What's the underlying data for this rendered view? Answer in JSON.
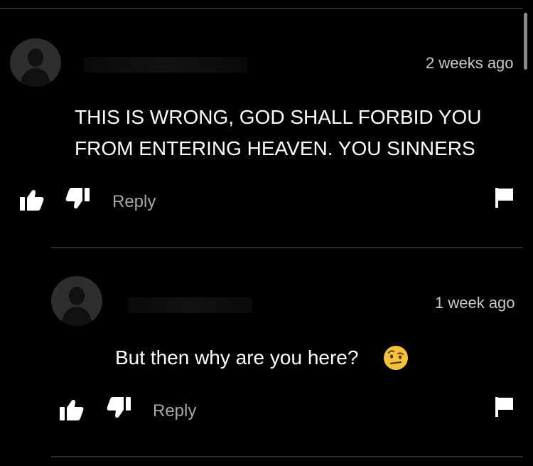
{
  "comments": [
    {
      "timestamp": "2 weeks ago",
      "text_lines": [
        "THIS IS WRONG, GOD SHALL FORBID YOU",
        "FROM ENTERING HEAVEN. YOU SINNERS"
      ],
      "reply_label": "Reply",
      "icons": [
        "like-icon",
        "dislike-icon",
        "flag-icon"
      ]
    },
    {
      "timestamp": "1 week ago",
      "text": "But then why are you here?",
      "emoji": "raised-eyebrow-face",
      "reply_label": "Reply",
      "icons": [
        "like-icon",
        "dislike-icon",
        "flag-icon"
      ]
    }
  ],
  "colors": {
    "background": "#000000",
    "text": "#ffffff",
    "muted": "#a7a7a7",
    "divider": "#2b2b2b",
    "avatar": "#2e2e2e",
    "emoji": "#f5c33b"
  }
}
